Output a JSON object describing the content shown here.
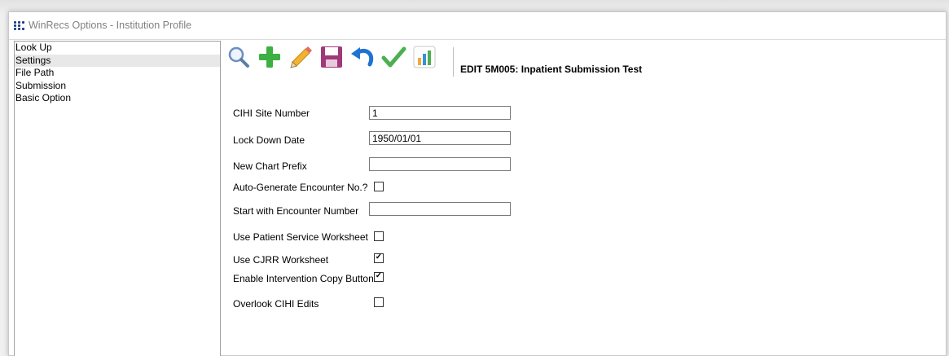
{
  "window": {
    "title": "WinRecs Options - Institution Profile"
  },
  "sidebar": {
    "items": [
      {
        "label": "Look Up"
      },
      {
        "label": "Settings"
      },
      {
        "label": "File Path"
      },
      {
        "label": "Submission"
      },
      {
        "label": "Basic Option"
      }
    ]
  },
  "toolbar": {
    "buttons": [
      "search-icon",
      "add-icon",
      "edit-pencil-icon",
      "save-disk-icon",
      "undo-icon",
      "check-icon",
      "chart-icon"
    ]
  },
  "header": {
    "edit_title": "EDIT 5M005: Inpatient Submission Test"
  },
  "form": {
    "cihi_site_number": {
      "label": "CIHI Site Number",
      "value": "1"
    },
    "lock_down_date": {
      "label": "Lock Down Date",
      "value": "1950/01/01"
    },
    "new_chart_prefix": {
      "label": "New Chart Prefix",
      "value": ""
    },
    "auto_generate_encounter": {
      "label": "Auto-Generate Encounter No.?",
      "checked": false
    },
    "start_encounter_number": {
      "label": "Start with Encounter Number",
      "value": ""
    },
    "use_patient_service_worksheet": {
      "label": "Use Patient Service Worksheet",
      "checked": false
    },
    "use_cjrr_worksheet": {
      "label": "Use CJRR Worksheet",
      "checked": true
    },
    "enable_intervention_copy": {
      "label": "Enable Intervention Copy Button",
      "checked": true
    },
    "overlook_cihi_edits": {
      "label": "Overlook CIHI Edits",
      "checked": false
    }
  },
  "colors": {
    "app_icon": "#1f3b8c",
    "add": "#3cb043",
    "check": "#4caf50",
    "save": "#a0397a",
    "undo": "#1e73d2",
    "search": "#5a7ea8"
  }
}
